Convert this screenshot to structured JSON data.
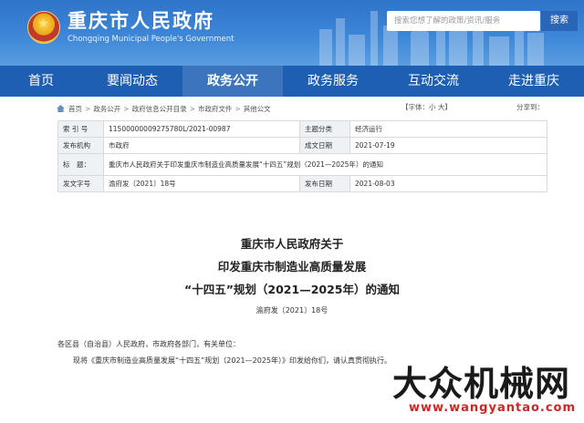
{
  "header": {
    "title": "重庆市人民政府",
    "subtitle": "Chongqing Municipal People's Government",
    "search_placeholder": "搜索您想了解的政策/资讯/服务",
    "search_button": "搜索"
  },
  "nav": {
    "items": [
      {
        "label": "首页"
      },
      {
        "label": "要闻动态"
      },
      {
        "label": "政务公开"
      },
      {
        "label": "政务服务"
      },
      {
        "label": "互动交流"
      },
      {
        "label": "走进重庆"
      }
    ],
    "active": "政务公开"
  },
  "breadcrumb": {
    "items": [
      "首页",
      "政务公开",
      "政府信息公开目录",
      "市政府文件",
      "其他公文"
    ],
    "separator": ">"
  },
  "font_size": {
    "prefix": "【字体：",
    "small": "小",
    "large": "大",
    "suffix": "】"
  },
  "share_label": "分享到：",
  "info": {
    "index_key": "索 引 号",
    "index_val": "11500000009275780L/2021-00987",
    "subject_key": "主题分类",
    "subject_val": "经济运行",
    "issuer_key": "发布机构",
    "issuer_val": "市政府",
    "created_key": "成文日期",
    "created_val": "2021-07-19",
    "title_key": "标　题：",
    "title_val": "重庆市人民政府关于印发重庆市制造业高质量发展“十四五”规划（2021—2025年）的通知",
    "docno_key": "发文字号",
    "docno_val": "渝府发〔2021〕18号",
    "published_key": "发布日期",
    "published_val": "2021-08-03"
  },
  "document": {
    "title_line1": "重庆市人民政府关于",
    "title_line2": "印发重庆市制造业高质量发展",
    "title_line3": "“十四五”规划（2021—2025年）的通知",
    "number": "渝府发〔2021〕18号",
    "addressee": "各区县（自治县）人民政府，市政府各部门，有关单位：",
    "body": "现将《重庆市制造业高质量发展“十四五”规划（2021—2025年）》印发给你们，请认真贯彻执行。"
  },
  "watermark": {
    "text": "大众机械网",
    "url": "www.wangyantao.com"
  },
  "colors": {
    "header_blue": "#3d86d8",
    "nav_blue": "#1e5fb3",
    "table_key_bg": "#eef2f7",
    "watermark_red": "#d32424"
  }
}
